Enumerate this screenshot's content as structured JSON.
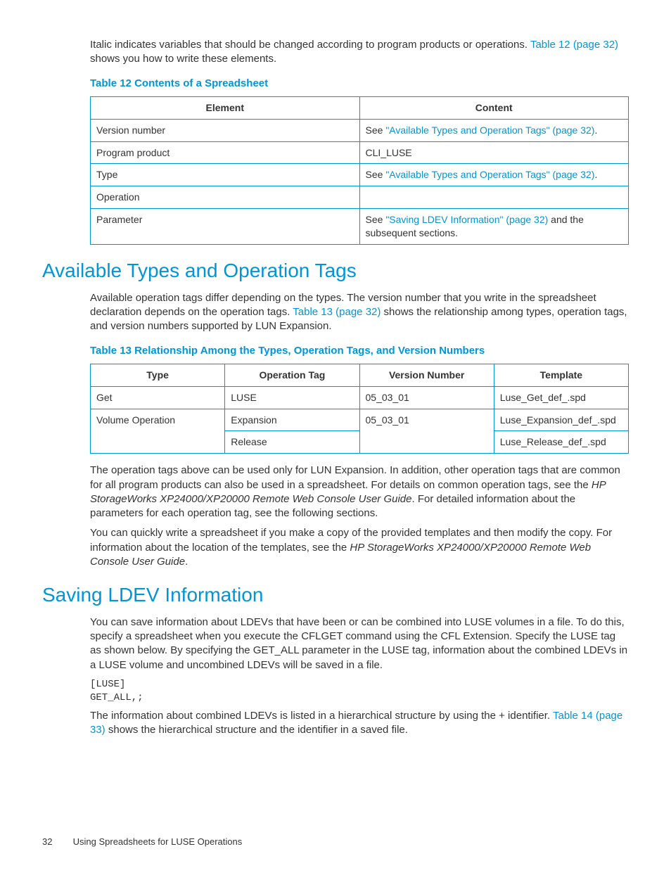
{
  "intro": {
    "p1_a": "Italic indicates variables that should be changed according to program products or operations. ",
    "p1_link": "Table 12 (page 32)",
    "p1_b": " shows you how to write these elements."
  },
  "table12": {
    "caption": "Table 12 Contents of a Spreadsheet",
    "headers": {
      "c1": "Element",
      "c2": "Content"
    },
    "rows": [
      {
        "element": "Version number",
        "prefix": "See ",
        "link": "\"Available Types and Operation Tags\" (page 32)",
        "suffix": "."
      },
      {
        "element": "Program product",
        "content": "CLI_LUSE"
      },
      {
        "element": "Type",
        "prefix": "See ",
        "link": "\"Available Types and Operation Tags\" (page 32)",
        "suffix": "."
      },
      {
        "element": "Operation",
        "content": ""
      },
      {
        "element": "Parameter",
        "prefix": "See ",
        "link": "\"Saving LDEV Information\" (page 32)",
        "suffix": " and the subsequent sections."
      }
    ]
  },
  "section1": {
    "title": "Available Types and Operation Tags",
    "p1_a": "Available operation tags differ depending on the types. The version number that you write in the spreadsheet declaration depends on the operation tags. ",
    "p1_link": "Table 13 (page 32)",
    "p1_b": " shows the relationship among types, operation tags, and version numbers supported by LUN Expansion."
  },
  "table13": {
    "caption": "Table 13 Relationship Among the Types, Operation Tags, and Version Numbers",
    "headers": {
      "c1": "Type",
      "c2": "Operation Tag",
      "c3": "Version Number",
      "c4": "Template"
    },
    "rows": [
      {
        "type": "Get",
        "tag": "LUSE",
        "version": "05_03_01",
        "template": "Luse_Get_def_.spd"
      },
      {
        "type": "Volume Operation",
        "tag": "Expansion",
        "version": "05_03_01",
        "template": "Luse_Expansion_def_.spd"
      },
      {
        "tag": "Release",
        "version": "",
        "template": "Luse_Release_def_.spd"
      }
    ]
  },
  "section1_after": {
    "p1_a": "The operation tags above can be used only for LUN Expansion. In addition, other operation tags that are common for all program products can also be used in a spreadsheet. For details on common operation tags, see the ",
    "p1_i": "HP StorageWorks XP24000/XP20000 Remote Web Console User Guide",
    "p1_b": ". For detailed information about the parameters for each operation tag, see the following sections.",
    "p2_a": "You can quickly write a spreadsheet if you make a copy of the provided templates and then modify the copy. For information about the location of the templates, see the ",
    "p2_i": "HP StorageWorks XP24000/XP20000 Remote Web Console User Guide",
    "p2_b": "."
  },
  "section2": {
    "title": "Saving LDEV Information",
    "p1": "You can save information about LDEVs that have been or can be combined into LUSE volumes in a file. To do this, specify a spreadsheet when you execute the CFLGET command using the CFL Extension. Specify the LUSE tag as shown below. By specifying the GET_ALL parameter in the LUSE tag, information about the combined LDEVs in a LUSE volume and uncombined LDEVs will be saved in a file.",
    "code": "[LUSE]\nGET_ALL,;",
    "p2_a": "The information about combined LDEVs is listed in a hierarchical structure by using the + identifier. ",
    "p2_link": "Table 14 (page 33)",
    "p2_b": " shows the hierarchical structure and the identifier in a saved file."
  },
  "footer": {
    "page": "32",
    "title": "Using Spreadsheets for LUSE Operations"
  }
}
